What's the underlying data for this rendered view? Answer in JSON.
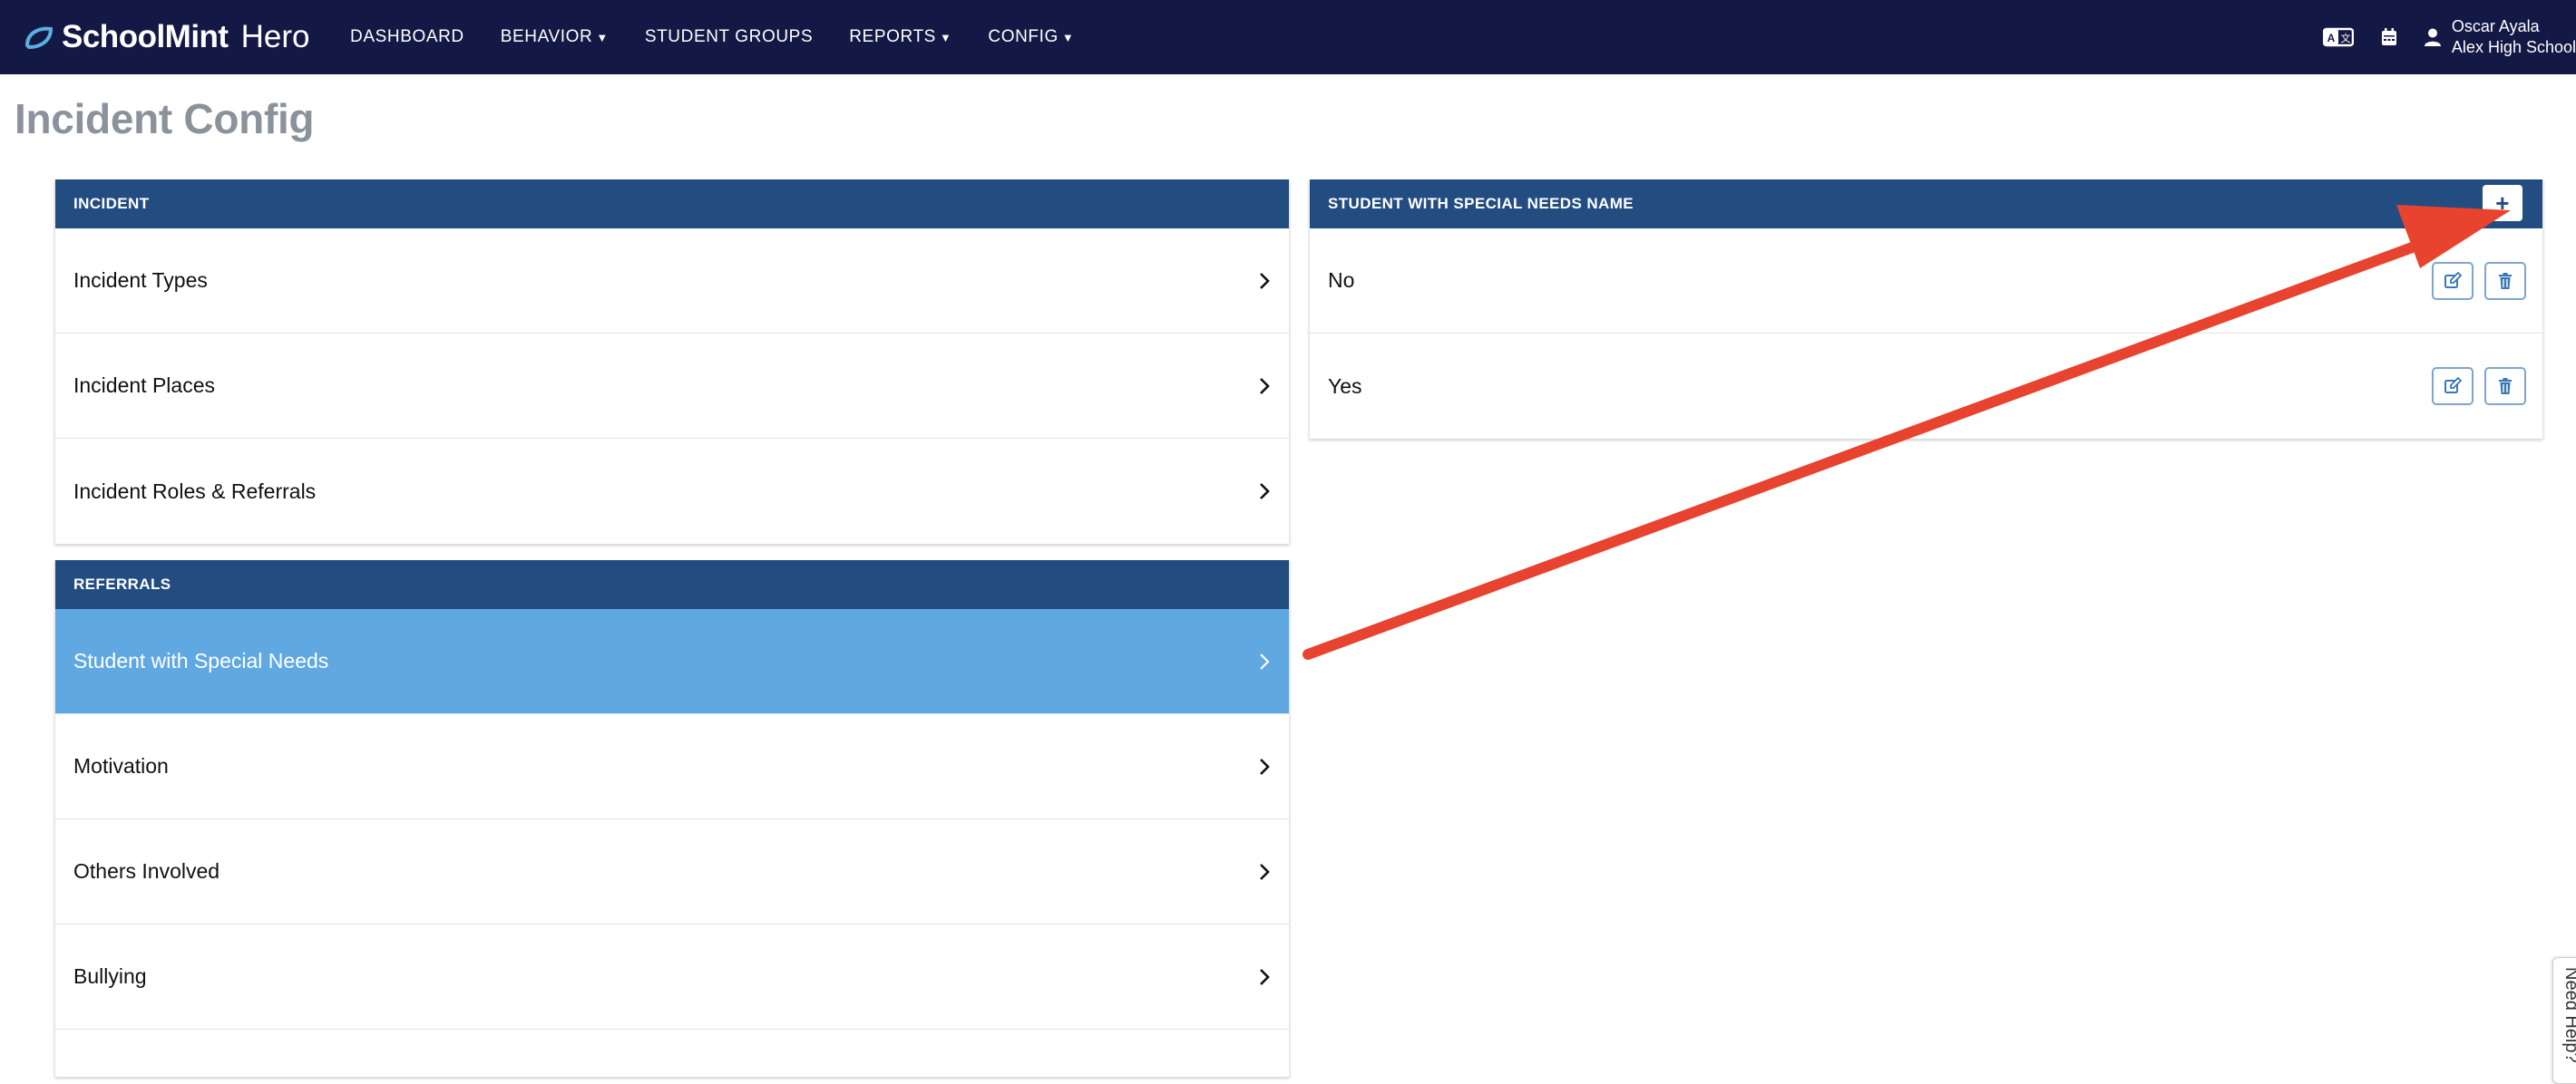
{
  "brand": {
    "name": "SchoolMint",
    "sub": "Hero"
  },
  "nav": {
    "links": [
      {
        "label": "DASHBOARD",
        "caret": false
      },
      {
        "label": "BEHAVIOR",
        "caret": true
      },
      {
        "label": "STUDENT GROUPS",
        "caret": false
      },
      {
        "label": "REPORTS",
        "caret": true
      },
      {
        "label": "CONFIG",
        "caret": true
      }
    ],
    "user": {
      "name": "Oscar Ayala",
      "school": "Alex High School"
    },
    "icons": [
      "translate-icon",
      "calendar-icon",
      "user-icon"
    ]
  },
  "page": {
    "title": "Incident Config"
  },
  "incident_panel": {
    "header": "INCIDENT",
    "items": [
      "Incident Types",
      "Incident Places",
      "Incident Roles & Referrals"
    ]
  },
  "referrals_panel": {
    "header": "REFERRALS",
    "items": [
      "Student with Special Needs",
      "Motivation",
      "Others Involved",
      "Bullying"
    ],
    "active_index": 0
  },
  "detail_panel": {
    "header": "STUDENT WITH SPECIAL NEEDS NAME",
    "add_label": "+",
    "items": [
      "No",
      "Yes"
    ]
  },
  "help": {
    "label": "Need Help?"
  },
  "colors": {
    "navbar": "#141845",
    "panel_header": "#234c81",
    "active_row": "#5fa8e2",
    "annotation_arrow": "#e8432e",
    "title": "#8a929c"
  }
}
